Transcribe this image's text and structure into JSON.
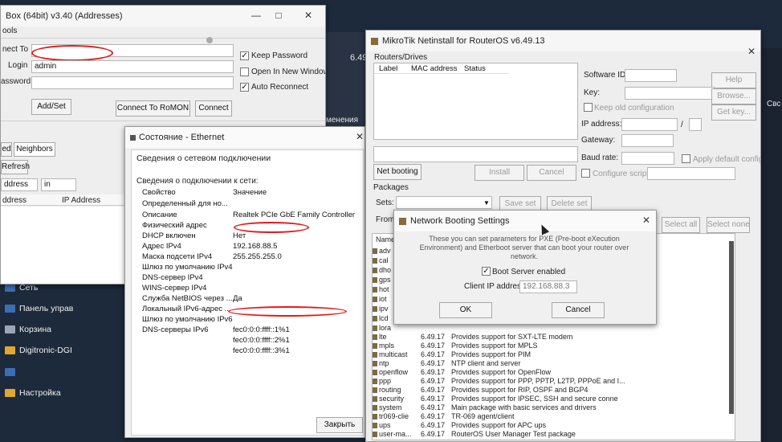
{
  "winbox": {
    "title": "Box (64bit) v3.40 (Addresses)",
    "menu": "ools",
    "connect_to_label": "nect To",
    "login_label": "Login",
    "login_value": "admin",
    "password_label": "assword",
    "keep_password": "Keep Password",
    "open_new_window": "Open In New Window",
    "auto_reconnect": "Auto Reconnect",
    "add_set": "Add/Set",
    "connect_romon": "Connect To RoMON",
    "connect": "Connect",
    "tab_active": "ed",
    "tab_neighbors": "Neighbors",
    "refresh": "Refresh",
    "filter_field": "ddress",
    "filter_op": "in",
    "col_address": "ddress",
    "col_ip": "IP Address"
  },
  "bg": {
    "version_fragment": "6.49",
    "menu_fragment": "менения",
    "right_fragment": "Свс"
  },
  "desktop": {
    "items": [
      {
        "label": "Сеть"
      },
      {
        "label": "Панель управ"
      },
      {
        "label": "Корзина"
      },
      {
        "label": "Digitronic-DGI"
      },
      {
        "label": "Настройка"
      }
    ]
  },
  "ethernet": {
    "title": "Состояние - Ethernet",
    "header": "Сведения о сетевом подключении",
    "section": "Сведения о подключении к сети:",
    "col_prop": "Свойство",
    "col_val": "Значение",
    "rows": [
      {
        "k": "Определенный для но...",
        "v": ""
      },
      {
        "k": "Описание",
        "v": "Realtek PCIe GbE Family Controller"
      },
      {
        "k": "Физический адрес",
        "v": ""
      },
      {
        "k": "DHCP включен",
        "v": "Нет"
      },
      {
        "k": "Адрес IPv4",
        "v": "192.168.88.5"
      },
      {
        "k": "Маска подсети IPv4",
        "v": "255.255.255.0"
      },
      {
        "k": "Шлюз по умолчанию IPv4",
        "v": ""
      },
      {
        "k": "DNS-сервер IPv4",
        "v": ""
      },
      {
        "k": "WINS-сервер IPv4",
        "v": ""
      },
      {
        "k": "Служба NetBIOS через ...",
        "v": "Да"
      },
      {
        "k": "Локальный IPv6-адрес ...",
        "v": ""
      },
      {
        "k": "Шлюз по умолчанию IPv6",
        "v": ""
      },
      {
        "k": "DNS-серверы IPv6",
        "v": "fec0:0:0:ffff::1%1"
      },
      {
        "k": "",
        "v": "fec0:0:0:ffff::2%1"
      },
      {
        "k": "",
        "v": "fec0:0:0:ffff::3%1"
      }
    ],
    "close_btn": "Закрыть"
  },
  "netinstall": {
    "title": "MikroTik Netinstall for RouterOS v6.49.13",
    "routers_label": "Routers/Drives",
    "col_label": "Label",
    "col_mac": "MAC address",
    "col_status": "Status",
    "software_id": "Software ID:",
    "key": "Key:",
    "keep_old": "Keep old configuration",
    "ip_address": "IP address:",
    "gateway": "Gateway:",
    "baud_rate": "Baud rate:",
    "apply_default": "Apply default config",
    "configure_script": "Configure script:",
    "help": "Help",
    "browse": "Browse...",
    "get_key": "Get key...",
    "net_booting": "Net booting",
    "install": "Install",
    "cancel": "Cancel",
    "packages_label": "Packages",
    "sets_label": "Sets:",
    "save_set": "Save set",
    "delete_set": "Delete set",
    "from_label": "From:",
    "select_all": "Select all",
    "select_none": "Select none",
    "name_col": "Name",
    "pkg_partial": [
      "adv",
      "cal",
      "dho",
      "gps",
      "hot",
      "iot",
      "ipv",
      "lcd",
      "lora"
    ],
    "packages": [
      {
        "name": "lte",
        "ver": "6.49.17",
        "desc": "Provides support for SXT-LTE modem"
      },
      {
        "name": "mpls",
        "ver": "6.49.17",
        "desc": "Provides support for MPLS"
      },
      {
        "name": "multicast",
        "ver": "6.49.17",
        "desc": "Provides support for PIM"
      },
      {
        "name": "ntp",
        "ver": "6.49.17",
        "desc": "NTP client and server"
      },
      {
        "name": "openflow",
        "ver": "6.49.17",
        "desc": "Provides support for OpenFlow"
      },
      {
        "name": "ppp",
        "ver": "6.49.17",
        "desc": "Provides support for PPP, PPTP, L2TP, PPPoE and I..."
      },
      {
        "name": "routing",
        "ver": "6.49.17",
        "desc": "Provides support for RIP, OSPF and BGP4"
      },
      {
        "name": "security",
        "ver": "6.49.17",
        "desc": "Provides support for IPSEC, SSH and secure conne"
      },
      {
        "name": "system",
        "ver": "6.49.17",
        "desc": "Main package with basic services and drivers"
      },
      {
        "name": "tr069-clie",
        "ver": "6.49.17",
        "desc": "TR-069 agent/client"
      },
      {
        "name": "ups",
        "ver": "6.49.17",
        "desc": "Provides support for APC ups"
      },
      {
        "name": "user-ma...",
        "ver": "6.49.17",
        "desc": "RouterOS User Manager Test package"
      }
    ]
  },
  "netboot": {
    "title": "Network Booting Settings",
    "description": "These you can set parameters for PXE (Pre-boot eXecution Environment) and Etherboot server that can boot your router over network.",
    "boot_server": "Boot Server enabled",
    "client_ip_label": "Client IP address:",
    "client_ip_value": "192.168.88.3",
    "ok": "OK",
    "cancel": "Cancel"
  }
}
